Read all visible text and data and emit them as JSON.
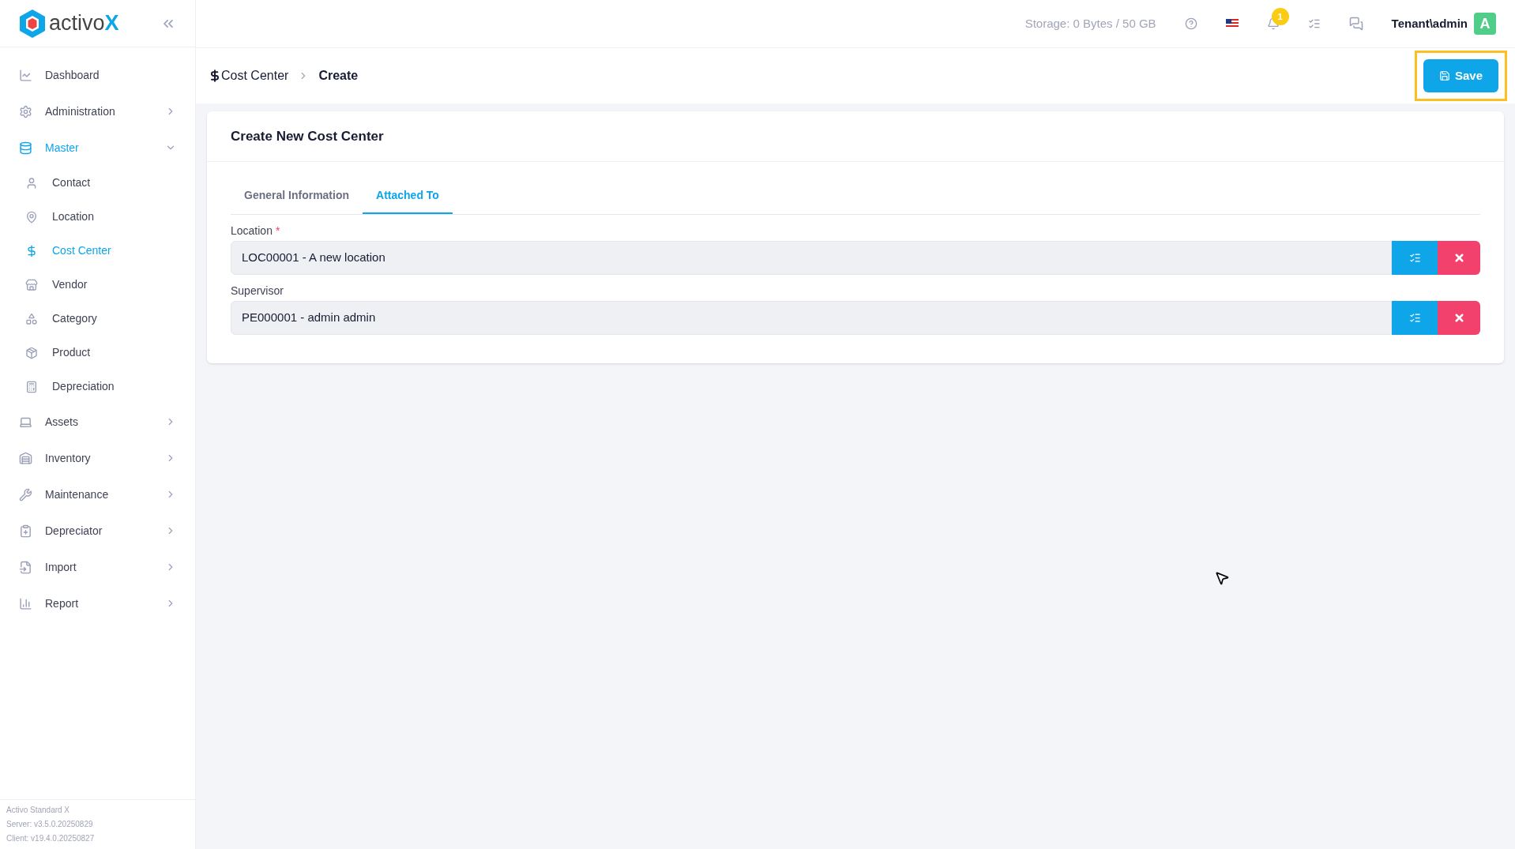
{
  "logo": {
    "text": "activo",
    "accent": "X"
  },
  "sidebar": {
    "items": [
      {
        "label": "Dashboard",
        "kind": "link",
        "selected": false
      },
      {
        "label": "Administration",
        "kind": "group",
        "expanded": false,
        "selected": false
      },
      {
        "label": "Master",
        "kind": "group",
        "expanded": true,
        "selected": true,
        "children": [
          {
            "label": "Contact",
            "selected": false
          },
          {
            "label": "Location",
            "selected": false
          },
          {
            "label": "Cost Center",
            "selected": true
          },
          {
            "label": "Vendor",
            "selected": false
          },
          {
            "label": "Category",
            "selected": false
          },
          {
            "label": "Product",
            "selected": false
          },
          {
            "label": "Depreciation",
            "selected": false
          }
        ]
      },
      {
        "label": "Assets",
        "kind": "group",
        "expanded": false,
        "selected": false
      },
      {
        "label": "Inventory",
        "kind": "group",
        "expanded": false,
        "selected": false
      },
      {
        "label": "Maintenance",
        "kind": "group",
        "expanded": false,
        "selected": false
      },
      {
        "label": "Depreciator",
        "kind": "group",
        "expanded": false,
        "selected": false
      },
      {
        "label": "Import",
        "kind": "group",
        "expanded": false,
        "selected": false
      },
      {
        "label": "Report",
        "kind": "group",
        "expanded": false,
        "selected": false
      }
    ],
    "footer": [
      "Activo Standard X",
      "Server: v3.5.0.20250829",
      "Client: v19.4.0.20250827"
    ]
  },
  "topbar": {
    "storage": "Storage: 0 Bytes / 50 GB",
    "notification_count": "1",
    "user": "Tenant\\admin",
    "avatar": "A"
  },
  "breadcrumb": [
    "Cost Center",
    "Create"
  ],
  "save_button": {
    "label": "Save",
    "highlighted": true
  },
  "card": {
    "title": "Create New Cost Center",
    "tabs": [
      {
        "label": "General Information",
        "selected": false
      },
      {
        "label": "Attached To",
        "selected": true
      }
    ],
    "fields": [
      {
        "label": "Location",
        "required_mark": "*",
        "value": "LOC00001 - A new location"
      },
      {
        "label": "Supervisor",
        "value": "PE000001 - admin admin"
      }
    ]
  }
}
